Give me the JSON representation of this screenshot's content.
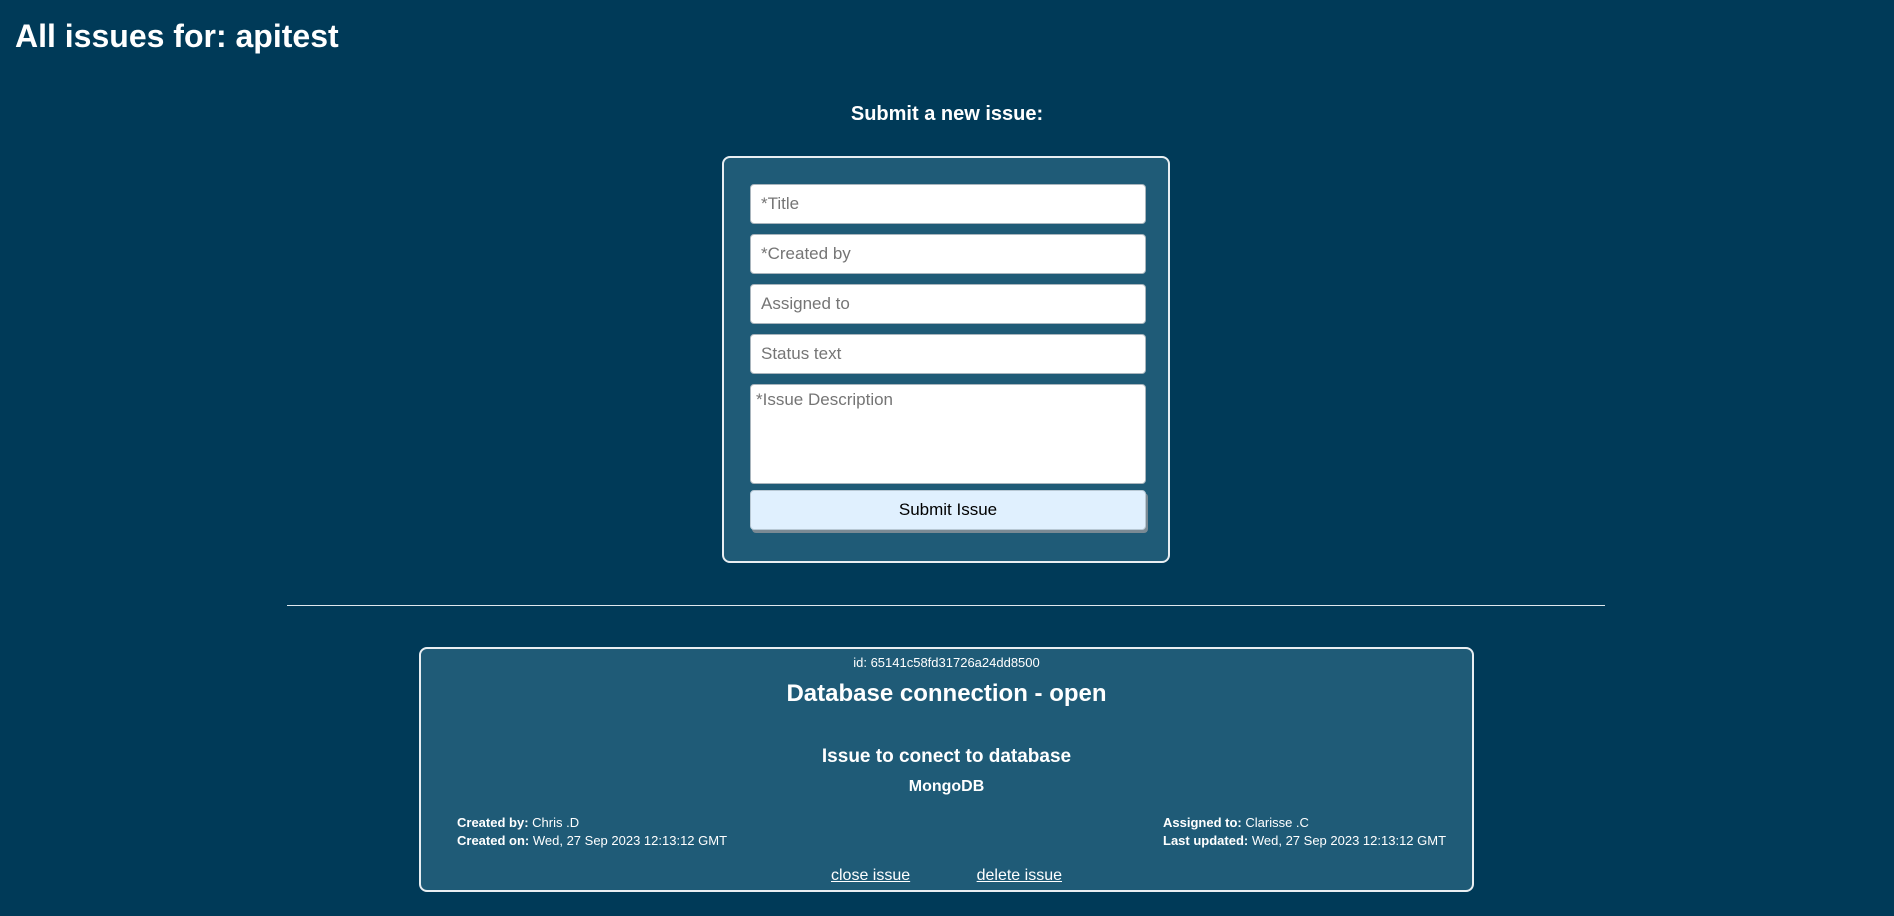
{
  "header": {
    "title": "All issues for: apitest"
  },
  "form": {
    "heading": "Submit a new issue:",
    "title_placeholder": "*Title",
    "created_by_placeholder": "*Created by",
    "assigned_to_placeholder": "Assigned to",
    "status_text_placeholder": "Status text",
    "description_placeholder": "*Issue Description",
    "submit_label": "Submit Issue"
  },
  "issues": [
    {
      "id_text": "id: 65141c58fd31726a24dd8500",
      "title": "Database connection -  open",
      "text": "Issue to conect to database",
      "text_sub": "MongoDB",
      "created_by_label": "Created by:",
      "created_by": "Chris .D",
      "created_on_label": "Created on:",
      "created_on": "Wed, 27 Sep 2023 12:13:12 GMT",
      "assigned_to_label": "Assigned to:",
      "assigned_to": "Clarisse .C",
      "last_updated_label": "Last updated:",
      "last_updated": "Wed, 27 Sep 2023 12:13:12 GMT",
      "close_label": "close issue",
      "delete_label": "delete issue"
    }
  ],
  "colors": {
    "background": "#003a58",
    "panel": "#1f5b77",
    "button": "#e0f0fe"
  }
}
